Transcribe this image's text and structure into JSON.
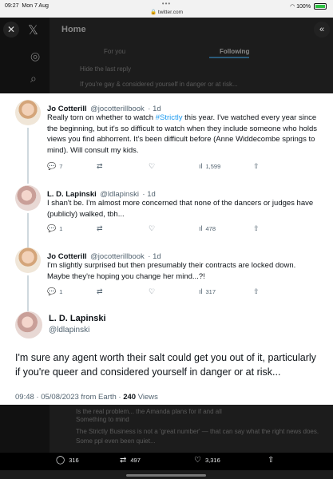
{
  "status_bar": {
    "time": "09:27",
    "date": "Mon 7 Aug",
    "url": "twitter.com",
    "dots": "•••",
    "battery_text": "100%"
  },
  "background": {
    "home_title": "Home",
    "tab_for_you": "For you",
    "tab_following": "Following",
    "hint_text_1": "Hide the last reply",
    "hint_text_2": "If you're gay & considered yourself in danger or at risk...",
    "bottom_text_1": "Is the real problem... the Amanda plans for if and all",
    "bottom_text_2": "Something to mind",
    "bottom_text_3": "The Strictly Business is not a 'great number' — that can say what the right news does.",
    "bottom_text_4": "Some ppl even been quiet..."
  },
  "tweets": [
    {
      "name": "Jo Cotterill",
      "handle": "@jocotterillbook",
      "age": "· 1d",
      "text_before": "Really torn on whether to watch ",
      "hashtag": "#Strictly",
      "text_after": " this year. I've watched every year since the beginning, but it's so difficult to watch when they include someone who holds views you find abhorrent. It's been difficult before (Anne Widdecombe springs to mind). Will consult my kids.",
      "replies": "7",
      "retweets": "",
      "likes": "",
      "views": "1,599"
    },
    {
      "name": "L. D. Lapinski",
      "handle": "@ldlapinski",
      "age": "· 1d",
      "text": "I shan't be. I'm almost more concerned that none of the dancers or judges have (publicly) walked, tbh...",
      "replies": "1",
      "retweets": "",
      "likes": "",
      "views": "478"
    },
    {
      "name": "Jo Cotterill",
      "handle": "@jocotterillbook",
      "age": "· 1d",
      "text": "I'm slightly surprised but then presumably their contracts are locked down. Maybe they're hoping you change her mind...?!",
      "replies": "1",
      "retweets": "",
      "likes": "",
      "views": "317"
    }
  ],
  "main_tweet": {
    "name": "L. D. Lapinski",
    "handle": "@ldlapinski",
    "text": "I'm sure any agent worth their salt could get you out of it, particularly if you're queer and considered yourself in danger or at risk...",
    "timestamp": "09:48 · 05/08/2023 from Earth ·",
    "views_count": "240",
    "views_label": "Views"
  },
  "bottom_bar": {
    "replies": "316",
    "retweets": "497",
    "likes": "3,316"
  },
  "icons": {
    "close": "close-icon",
    "x_logo": "x-logo-icon",
    "collapse": "double-chevron-left-icon"
  }
}
